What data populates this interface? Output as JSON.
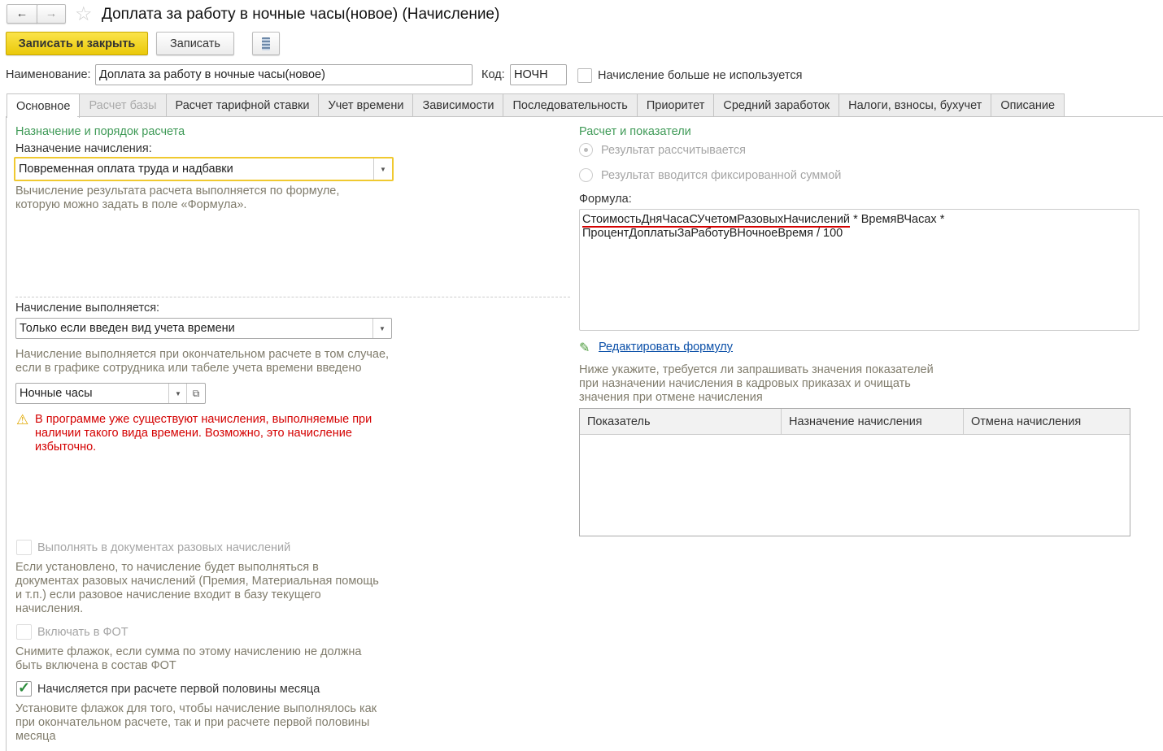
{
  "window": {
    "title": "Доплата за работу в ночные часы(новое) (Начисление)"
  },
  "toolbar": {
    "save_close": "Записать и закрыть",
    "save": "Записать"
  },
  "header": {
    "name_label": "Наименование:",
    "name_value": "Доплата за работу в ночные часы(новое)",
    "code_label": "Код:",
    "code_value": "НОЧН",
    "unused_label": "Начисление больше не используется"
  },
  "tabs": [
    "Основное",
    "Расчет базы",
    "Расчет тарифной ставки",
    "Учет времени",
    "Зависимости",
    "Последовательность",
    "Приоритет",
    "Средний заработок",
    "Налоги, взносы, бухучет",
    "Описание"
  ],
  "left": {
    "section_title": "Назначение и порядок расчета",
    "purpose_label": "Назначение начисления:",
    "purpose_value": "Повременная оплата труда и надбавки",
    "purpose_hint_1": "Вычисление результата расчета выполняется по формуле,",
    "purpose_hint_2": "которую можно задать в поле «Формула».",
    "performed_label": "Начисление выполняется:",
    "performed_value": "Только если введен вид учета времени",
    "performed_hint_1": "Начисление выполняется при окончательном расчете в том случае,",
    "performed_hint_2": "если в графике сотрудника или табеле учета времени введено",
    "time_type_value": "Ночные часы",
    "warning_1": "В программе уже существуют начисления, выполняемые при",
    "warning_2": "наличии такого вида времени. Возможно, это начисление",
    "warning_3": "избыточно.",
    "one_time_label": "Выполнять в документах разовых начислений",
    "one_time_hint": [
      "Если установлено, то начисление будет выполняться в",
      "документах разовых начислений (Премия, Материальная помощь",
      "и т.п.) если разовое начисление входит в базу текущего",
      "начисления."
    ],
    "fot_label": "Включать в ФОТ",
    "fot_hint": [
      "Снимите флажок, если сумма по этому начислению не должна",
      "быть включена в состав ФОТ"
    ],
    "first_half_label": "Начисляется при расчете первой половины месяца",
    "first_half_hint": [
      "Установите флажок для того, чтобы начисление выполнялось как",
      "при окончательном расчете, так и при расчете первой половины",
      "месяца"
    ]
  },
  "right": {
    "section_title": "Расчет и показатели",
    "radio_calc": "Результат рассчитывается",
    "radio_fixed": "Результат вводится фиксированной суммой",
    "formula_label": "Формула:",
    "formula_part1": "СтоимостьДняЧасаСУчетомРазовыхНачислений",
    "formula_part2": " * ВремяВЧасах *",
    "formula_line2": "ПроцентДоплатыЗаРаботуВНочноеВремя / 100",
    "edit_formula": "Редактировать формулу",
    "hint": [
      "Ниже укажите, требуется ли запрашивать значения показателей",
      "при назначении начисления в кадровых приказах и очищать",
      "значения при отмене начисления"
    ],
    "table_headers": [
      "Показатель",
      "Назначение начисления",
      "Отмена начисления"
    ]
  },
  "colors": {
    "accent": "#f5d60d",
    "green": "#3f9a57",
    "warning": "#d40000",
    "link": "#0a4fa8"
  }
}
